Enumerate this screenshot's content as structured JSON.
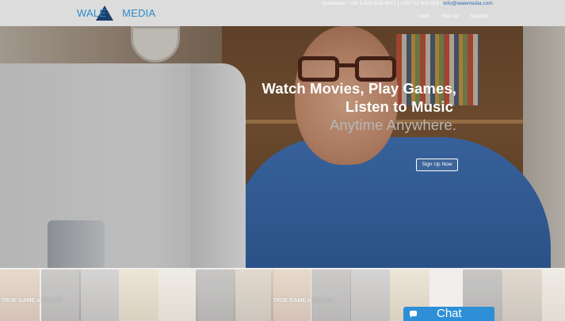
{
  "header": {
    "logo": {
      "part1": "WALE",
      "part2": "MEDIA"
    },
    "contact": {
      "questions": "Questions? +00 1-825-528-6517 | +357 22 000 818 |",
      "email": "info@walemedia.com"
    },
    "nav": {
      "login": "Login",
      "signup": "Sign up",
      "support": "Support"
    }
  },
  "hero": {
    "line1": "Watch Movies, Play Games,",
    "line2": "Listen to Music",
    "line3": "Anytime Anywhere.",
    "cta": "Sign Up Now"
  },
  "posters": {
    "titles": [
      "TRUE GAME of DEATH",
      "TRUE GAME of DEATH"
    ]
  },
  "chat": {
    "label": "Chat",
    "icon": "chat-bubble-icon"
  },
  "colors": {
    "header_bg": "#dcdcdc",
    "logo_blue": "#2e8bc9",
    "logo_triangle": "#1c3e6b",
    "chat_blue": "#2e8fd6",
    "email_link": "#2f6fb5"
  }
}
